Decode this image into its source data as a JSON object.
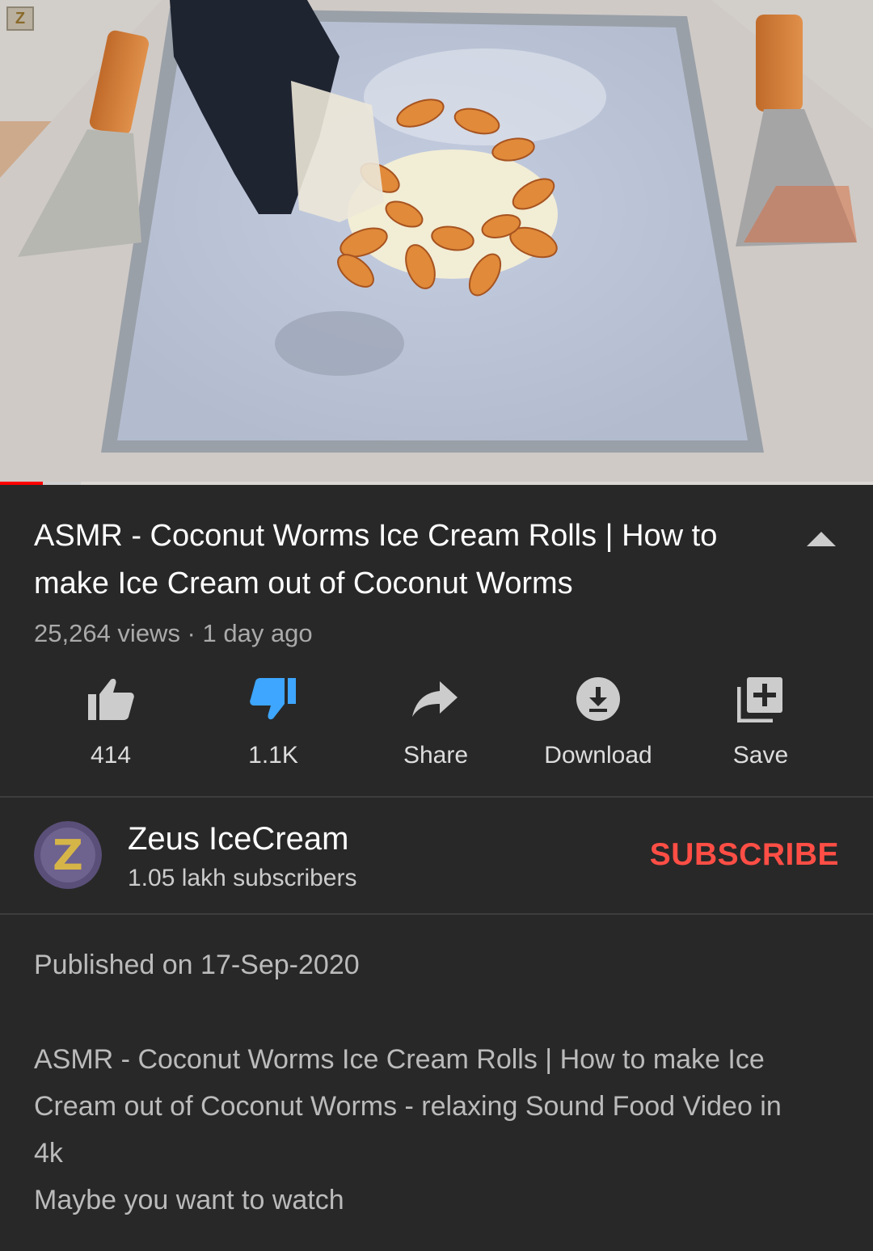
{
  "player": {
    "watermark": "Z",
    "progress_played_fraction": 0.049,
    "progress_buffered_fraction": 0.093
  },
  "video": {
    "title": "ASMR - Coconut Worms Ice Cream Rolls | How to make Ice Cream out of Coconut Worms",
    "meta": "25,264 views · 1 day ago"
  },
  "actions": [
    {
      "icon": "thumbs-up-icon",
      "label": "414"
    },
    {
      "icon": "thumbs-down-icon",
      "label": "1.1K"
    },
    {
      "icon": "share-icon",
      "label": "Share"
    },
    {
      "icon": "download-icon",
      "label": "Download"
    },
    {
      "icon": "add-to-playlist-icon",
      "label": "Save"
    }
  ],
  "channel": {
    "avatar_letter": "Z",
    "name": "Zeus IceCream",
    "subscribers": "1.05 lakh subscribers",
    "subscribe_label": "SUBSCRIBE"
  },
  "description": {
    "published": "Published on 17-Sep-2020",
    "lines": [
      "ASMR - Coconut Worms Ice Cream Rolls | How to make Ice",
      "Cream out of Coconut Worms - relaxing Sound Food Video in",
      "4k",
      "Maybe you want to watch"
    ]
  },
  "colors": {
    "background": "#282828",
    "subscribe": "#ff4e45",
    "dislike_active": "#3ea6ff",
    "progress": "#ff0000"
  }
}
